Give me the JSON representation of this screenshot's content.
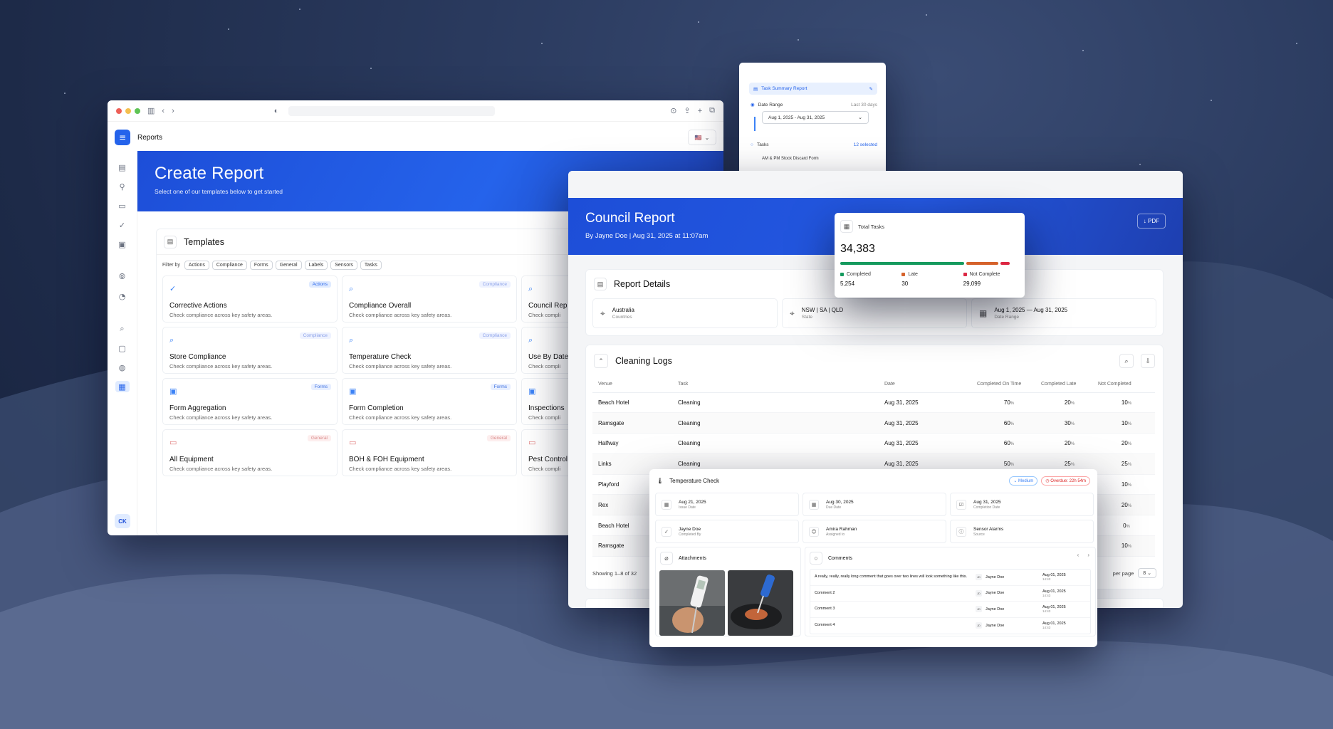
{
  "app": {
    "title": "Reports",
    "user_initials": "CK",
    "flag": "🇺🇸"
  },
  "create_report": {
    "title": "Create Report",
    "subtitle": "Select one of our templates below to get started",
    "templates_title": "Templates",
    "filter_label": "Filter by",
    "filters": [
      "Actions",
      "Compliance",
      "Forms",
      "General",
      "Labels",
      "Sensors",
      "Tasks"
    ],
    "templates": [
      {
        "name": "Corrective Actions",
        "desc": "Check compliance across key safety areas.",
        "badge": "Actions",
        "kind": "act",
        "icon": "check-circle-icon"
      },
      {
        "name": "Compliance Overall",
        "desc": "Check compliance across key safety areas.",
        "badge": "Compliance",
        "kind": "com",
        "icon": "search-check-icon"
      },
      {
        "name": "Council Rep",
        "desc": "Check compli",
        "badge": "",
        "kind": "com",
        "icon": "search-check-icon"
      },
      {
        "name": "Store Compliance",
        "desc": "Check compliance across key safety areas.",
        "badge": "Compliance",
        "kind": "com",
        "icon": "search-check-icon"
      },
      {
        "name": "Temperature Check",
        "desc": "Check compliance across key safety areas.",
        "badge": "Compliance",
        "kind": "com",
        "icon": "search-check-icon"
      },
      {
        "name": "Use By Date",
        "desc": "Check compli",
        "badge": "",
        "kind": "com",
        "icon": "search-check-icon"
      },
      {
        "name": "Form Aggregation",
        "desc": "Check compliance across key safety areas.",
        "badge": "Forms",
        "kind": "frm",
        "icon": "form-icon"
      },
      {
        "name": "Form Completion",
        "desc": "Check compliance across key safety areas.",
        "badge": "Forms",
        "kind": "frm",
        "icon": "form-icon"
      },
      {
        "name": "Inspections",
        "desc": "Check compli",
        "badge": "",
        "kind": "frm",
        "icon": "form-icon"
      },
      {
        "name": "All Equipment",
        "desc": "Check compliance across key safety areas.",
        "badge": "General",
        "kind": "gen",
        "icon": "folder-icon"
      },
      {
        "name": "BOH & FOH Equipment",
        "desc": "Check compliance across key safety areas.",
        "badge": "General",
        "kind": "gen",
        "icon": "folder-icon"
      },
      {
        "name": "Pest Control",
        "desc": "Check compli",
        "badge": "",
        "kind": "gen",
        "icon": "folder-icon"
      }
    ]
  },
  "task_summary": {
    "title": "Task Summary Report",
    "date_range_label": "Date Range",
    "date_range_hint": "Last 30 days",
    "date_range_value": "Aug 1, 2025 - Aug 31, 2025",
    "tasks_label": "Tasks",
    "tasks_selected": "12 selected",
    "first_task": "AM & PM Stock Discard Form"
  },
  "council": {
    "title": "Council Report",
    "byline": "By Jayne Doe  |  Aug 31, 2025 at 11:07am",
    "pdf_label": "↓ PDF",
    "details_title": "Report Details",
    "details": [
      {
        "value": "Australia",
        "sub": "Countries",
        "icon": "map-pin-icon"
      },
      {
        "value": "NSW | SA | QLD",
        "sub": "State",
        "icon": "map-pin-icon"
      },
      {
        "value": "Aug 1, 2025 — Aug 31, 2025",
        "sub": "Date Range",
        "icon": "calendar-icon"
      }
    ],
    "logs_title": "Cleaning Logs",
    "columns": [
      "Venue",
      "Task",
      "Date",
      "Completed On Time",
      "Completed Late",
      "Not Completed"
    ],
    "rows": [
      {
        "venue": "Beach Hotel",
        "task": "Cleaning",
        "date": "Aug 31, 2025",
        "on_time": "70",
        "late": "20",
        "not": "10"
      },
      {
        "venue": "Ramsgate",
        "task": "Cleaning",
        "date": "Aug 31, 2025",
        "on_time": "60",
        "late": "30",
        "not": "10"
      },
      {
        "venue": "Halfway",
        "task": "Cleaning",
        "date": "Aug 31, 2025",
        "on_time": "60",
        "late": "20",
        "not": "20"
      },
      {
        "venue": "Links",
        "task": "Cleaning",
        "date": "Aug 31, 2025",
        "on_time": "50",
        "late": "25",
        "not": "25"
      },
      {
        "venue": "Playford",
        "task": "",
        "date": "",
        "on_time": "",
        "late": "",
        "not": "10"
      },
      {
        "venue": "Rex",
        "task": "",
        "date": "",
        "on_time": "",
        "late": "",
        "not": "20"
      },
      {
        "venue": "Beach Hotel",
        "task": "",
        "date": "",
        "on_time": "",
        "late": "",
        "not": "0"
      },
      {
        "venue": "Ramsgate",
        "task": "",
        "date": "",
        "on_time": "",
        "late": "",
        "not": "10"
      }
    ],
    "pct_suffix": "%",
    "showing": "Showing 1–8 of 32",
    "per_page_label": "per page",
    "per_page_value": "8"
  },
  "total_tasks": {
    "title": "Total Tasks",
    "total": "34,383",
    "completed_label": "Completed",
    "completed": "5,254",
    "late_label": "Late",
    "late": "30",
    "not_label": "Not Complete",
    "not": "29,099",
    "bar_fractions": [
      0.69,
      0.18,
      0.05
    ],
    "colors": {
      "completed": "#159a5e",
      "late": "#d5622b",
      "not": "#dc2743"
    }
  },
  "temp_check": {
    "title": "Temperature Check",
    "priority": "Medium",
    "overdue": "Overdue: 22h 54m",
    "fields": [
      {
        "value": "Aug 21, 2025",
        "sub": "Issue Date",
        "icon": "calendar-icon"
      },
      {
        "value": "Aug 30, 2025",
        "sub": "Due Date",
        "icon": "calendar-icon"
      },
      {
        "value": "Aug 31, 2025",
        "sub": "Completion Date",
        "icon": "calendar-check-icon"
      },
      {
        "value": "Jayne Doe",
        "sub": "Completed By",
        "icon": "check-icon"
      },
      {
        "value": "Amira Rahman",
        "sub": "Assigned to",
        "icon": "user-icon"
      },
      {
        "value": "Sensor Alarms",
        "sub": "Source",
        "icon": "info-icon"
      }
    ],
    "attachments_label": "Attachments",
    "comments_label": "Comments",
    "comments": [
      {
        "text": "A really, really, really long comment that goes over two lines will look something like this.",
        "initials": "JD",
        "author": "Jayne Doe",
        "date": "Aug 01, 2025",
        "time": "14:43"
      },
      {
        "text": "Comment 2",
        "initials": "JD",
        "author": "Jayne Doe",
        "date": "Aug 01, 2025",
        "time": "14:43"
      },
      {
        "text": "Comment 3",
        "initials": "JD",
        "author": "Jayne Doe",
        "date": "Aug 01, 2025",
        "time": "14:43"
      },
      {
        "text": "Comment 4",
        "initials": "JD",
        "author": "Jayne Doe",
        "date": "Aug 01, 2025",
        "time": "14:43"
      }
    ]
  }
}
